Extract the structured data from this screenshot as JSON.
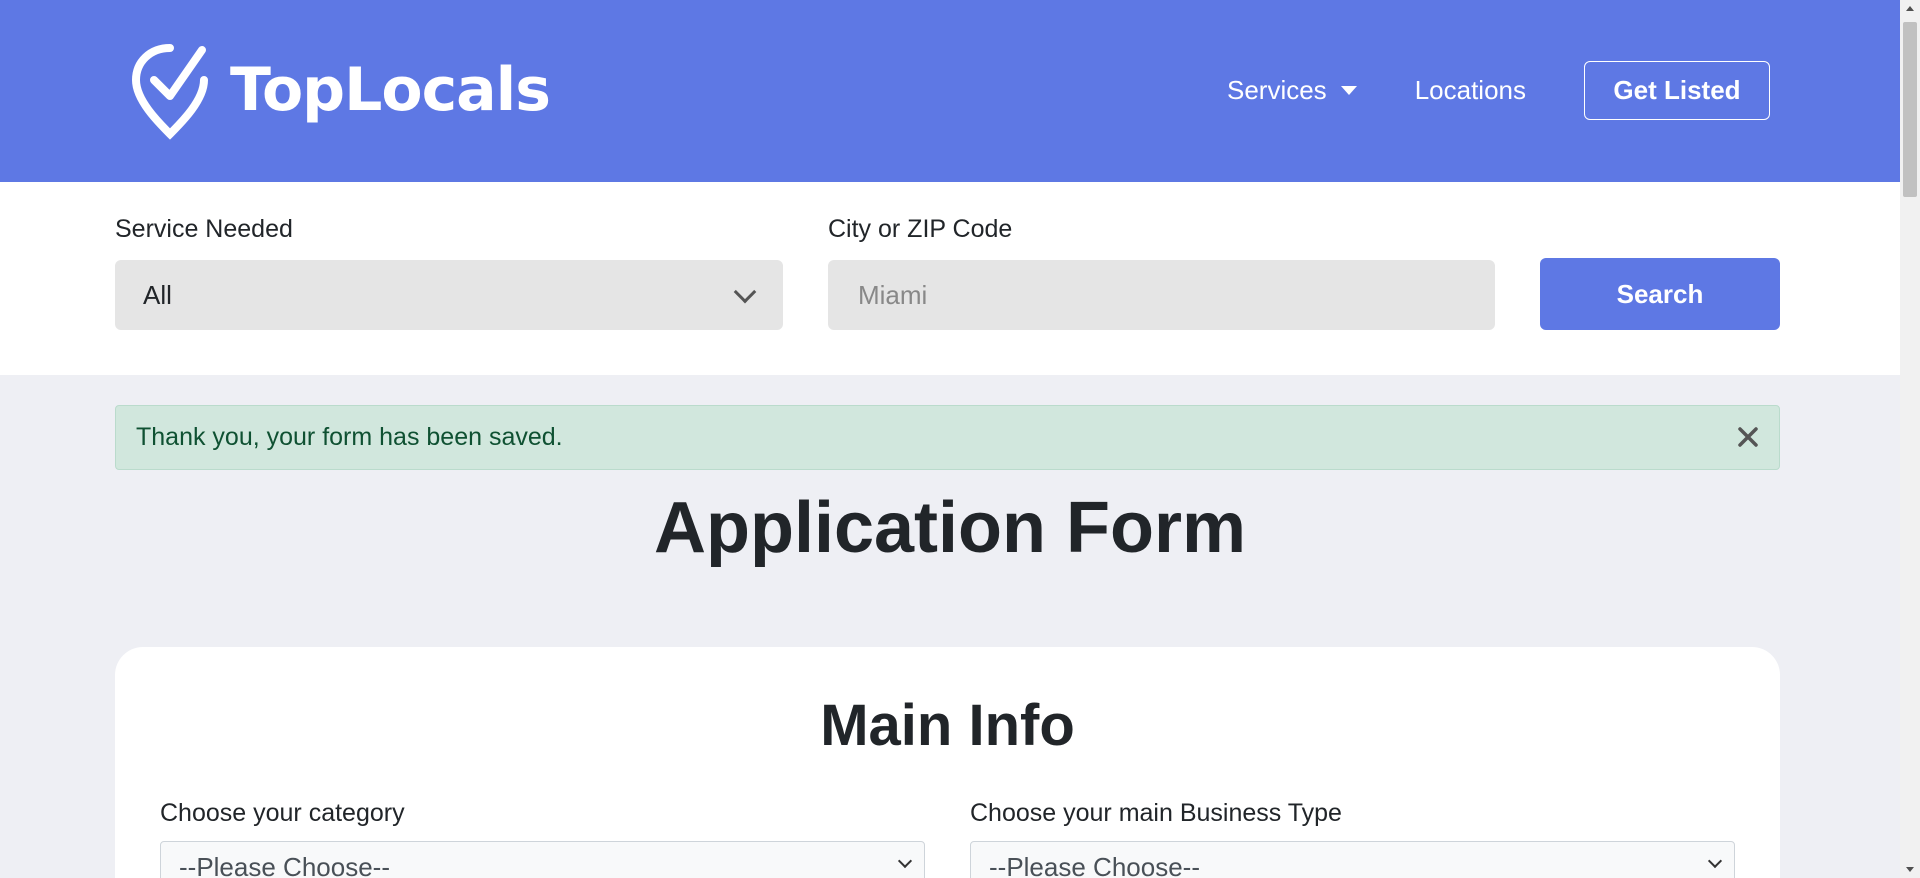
{
  "header": {
    "brand": "TopLocals",
    "nav": {
      "services_label": "Services",
      "locations_label": "Locations",
      "get_listed_label": "Get Listed"
    },
    "accent_color": "#5e78e4"
  },
  "search": {
    "service_label": "Service Needed",
    "service_value": "All",
    "city_label": "City or ZIP Code",
    "city_placeholder": "Miami",
    "button_label": "Search"
  },
  "alert": {
    "message": "Thank you, your form has been saved.",
    "background": "#d1e7dd",
    "text_color": "#0f5132"
  },
  "page": {
    "title": "Application Form"
  },
  "card": {
    "title": "Main Info",
    "category_label": "Choose your category",
    "category_value": "--Please Choose--",
    "business_type_label": "Choose your main Business Type",
    "business_type_value": "--Please Choose--"
  }
}
